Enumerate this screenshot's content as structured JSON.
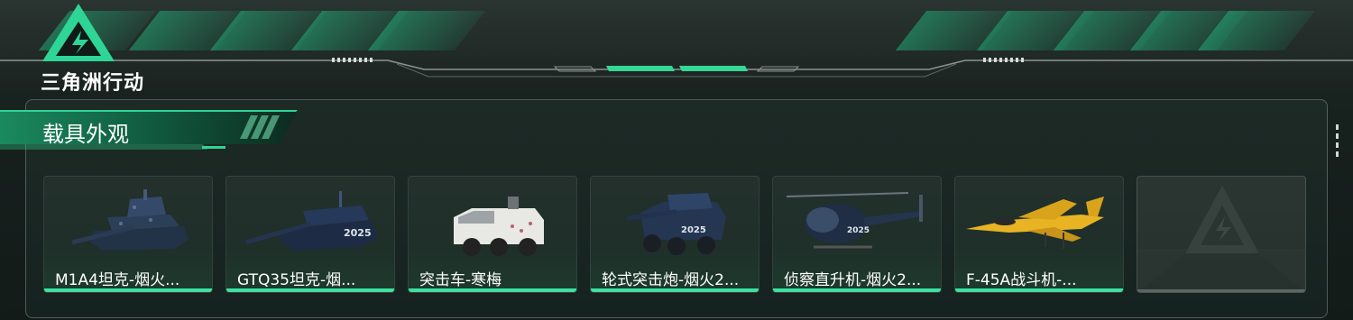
{
  "header": {
    "game_title": "三角洲行动"
  },
  "section": {
    "title": "载具外观"
  },
  "cards": [
    {
      "label": "M1A4坦克-烟火...",
      "icon": "tank-icon"
    },
    {
      "label": "GTQ35坦克-烟...",
      "icon": "tank-icon"
    },
    {
      "label": "突击车-寒梅",
      "icon": "assault-vehicle-icon"
    },
    {
      "label": "轮式突击炮-烟火2...",
      "icon": "wheeled-gun-icon"
    },
    {
      "label": "侦察直升机-烟火2...",
      "icon": "helicopter-icon"
    },
    {
      "label": "F-45A战斗机-...",
      "icon": "fighter-jet-icon"
    },
    {
      "label": "",
      "icon": "placeholder-logo-icon"
    }
  ],
  "colors": {
    "accent": "#3fe0a0",
    "brand_green": "#22c08a",
    "background": "#16201d"
  }
}
